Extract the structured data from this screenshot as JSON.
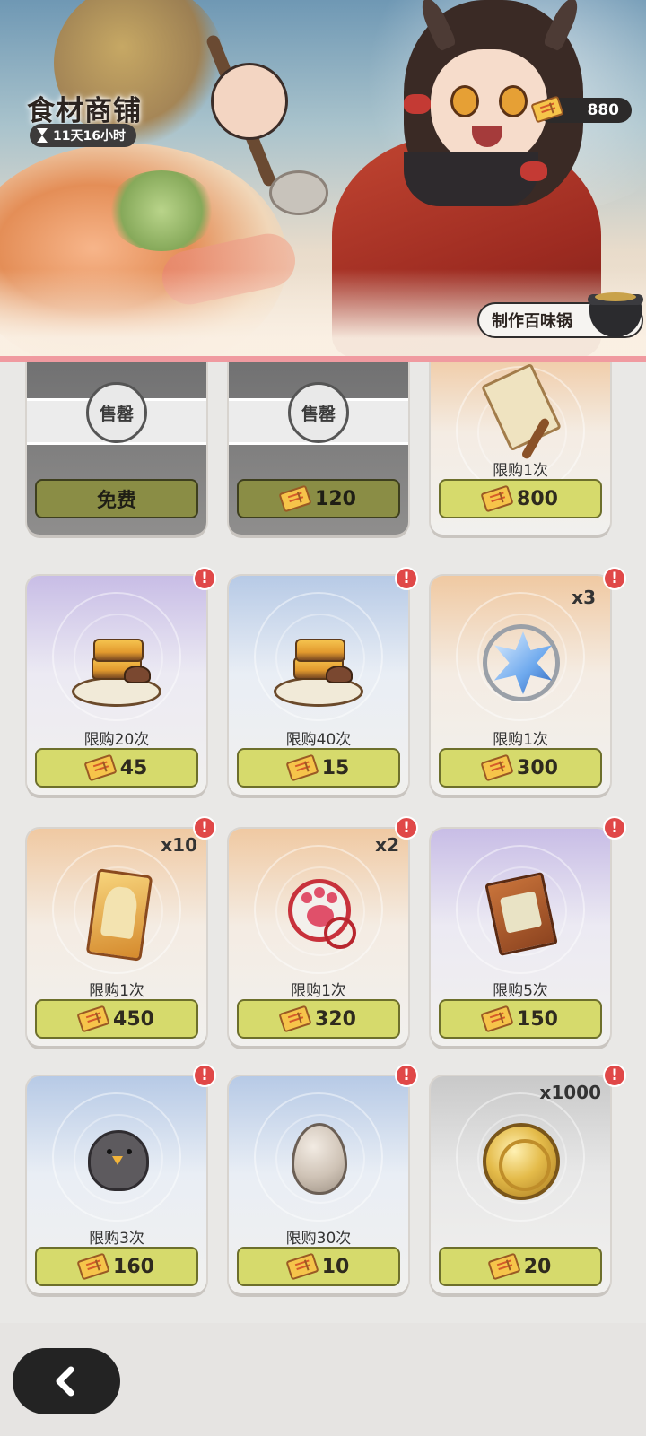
{
  "shop": {
    "title": "食材商铺",
    "timer": "11天16小时"
  },
  "currency": {
    "amount": "880",
    "icon": "ticket-icon"
  },
  "craft_button": {
    "label": "制作百味锅",
    "icon": "pot-icon"
  },
  "sold_label": "售罄",
  "items": [
    {
      "limit": "",
      "price": "免费",
      "qty": "",
      "alert": false,
      "sold": true,
      "art": "sold-out"
    },
    {
      "limit": "",
      "price": "120",
      "qty": "",
      "alert": false,
      "sold": true,
      "art": "sold-out"
    },
    {
      "limit": "限购1次",
      "price": "800",
      "qty": "",
      "alert": false,
      "sold": false,
      "art": "scroll-recipe-icon"
    },
    {
      "limit": "限购20次",
      "price": "45",
      "qty": "",
      "alert": true,
      "sold": false,
      "art": "tofu-dish-icon"
    },
    {
      "limit": "限购40次",
      "price": "15",
      "qty": "",
      "alert": true,
      "sold": false,
      "art": "tofu-dish-icon"
    },
    {
      "limit": "限购1次",
      "price": "300",
      "qty": "x3",
      "alert": true,
      "sold": false,
      "art": "crystal-icon"
    },
    {
      "limit": "限购1次",
      "price": "450",
      "qty": "x10",
      "alert": true,
      "sold": false,
      "art": "character-card-icon"
    },
    {
      "limit": "限购1次",
      "price": "320",
      "qty": "x2",
      "alert": true,
      "sold": false,
      "art": "paw-charm-icon"
    },
    {
      "limit": "限购5次",
      "price": "150",
      "qty": "",
      "alert": true,
      "sold": false,
      "art": "book-icon"
    },
    {
      "limit": "限购3次",
      "price": "160",
      "qty": "",
      "alert": true,
      "sold": false,
      "art": "bird-plush-icon"
    },
    {
      "limit": "限购30次",
      "price": "10",
      "qty": "",
      "alert": true,
      "sold": false,
      "art": "egg-icon"
    },
    {
      "limit": "",
      "price": "20",
      "qty": "x1000",
      "alert": true,
      "sold": false,
      "art": "gold-coin-icon"
    }
  ],
  "colors": {
    "price_button": "#d6da6c",
    "alert": "#e04848",
    "divider": "#f09aa0"
  },
  "nav": {
    "back_icon": "chevron-left-icon"
  }
}
